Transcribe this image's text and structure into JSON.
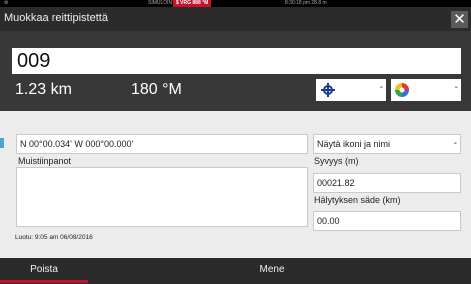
{
  "status": {
    "left": "SIMULOINT...",
    "badge": "$ VRG 888 °M",
    "right": "8:30:18 pm  28.8 m"
  },
  "dialog": {
    "title": "Muokkaa reittipistettä",
    "close_label": "✕"
  },
  "waypoint": {
    "name": "009",
    "distance": "1.23 km",
    "bearing": "180 °M",
    "icon_name": "crosshair-icon",
    "color_name": "multicolor-icon"
  },
  "form": {
    "position": "N 00°00.034'  W 000°00.000'",
    "display_option": "Näytä ikoni ja nimi",
    "notes_label": "Muistiinpanot",
    "notes_value": "",
    "depth_label": "Syvyys (m)",
    "depth_value": "00021.82",
    "alarm_label": "Hälytyksen säde (km)",
    "alarm_value": "00.00",
    "created": "Luotu: 9:05 am  06/08/2016"
  },
  "buttons": {
    "delete": "Poista",
    "goto": "Mene"
  },
  "colors": {
    "accent_red": "#c8102e",
    "panel_dark": "#383838",
    "form_bg": "#ececec"
  }
}
